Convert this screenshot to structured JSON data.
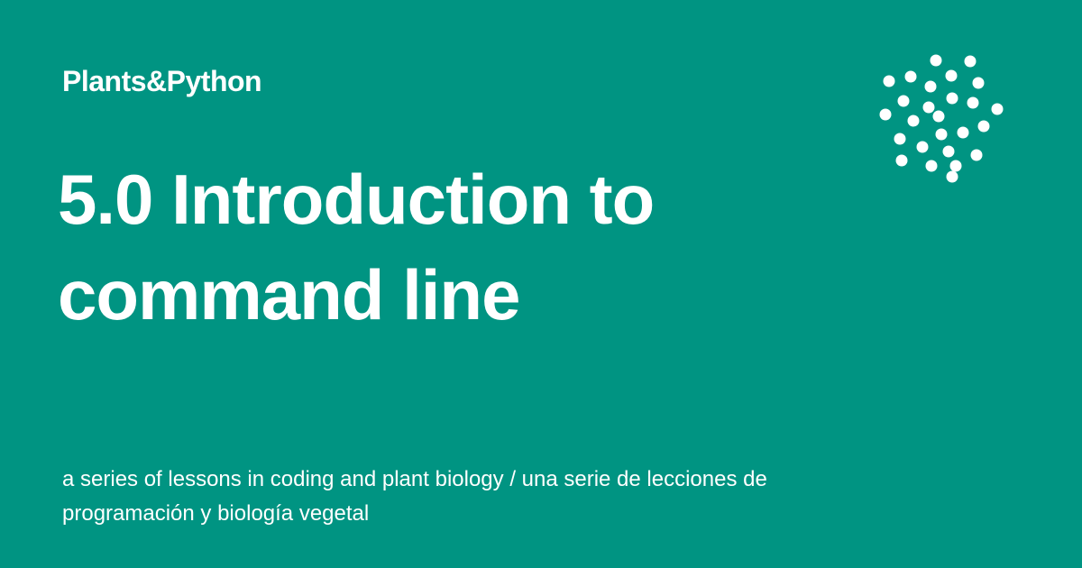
{
  "site": {
    "name": "Plants&Python"
  },
  "post": {
    "title": "5.0 Introduction to command line",
    "description": "a series of lessons in coding and plant biology / una serie de lecciones de programación y biología vegetal"
  },
  "theme": {
    "background": "#009482",
    "text": "#ffffff"
  },
  "logo": {
    "icon": "dot-cluster-icon"
  }
}
